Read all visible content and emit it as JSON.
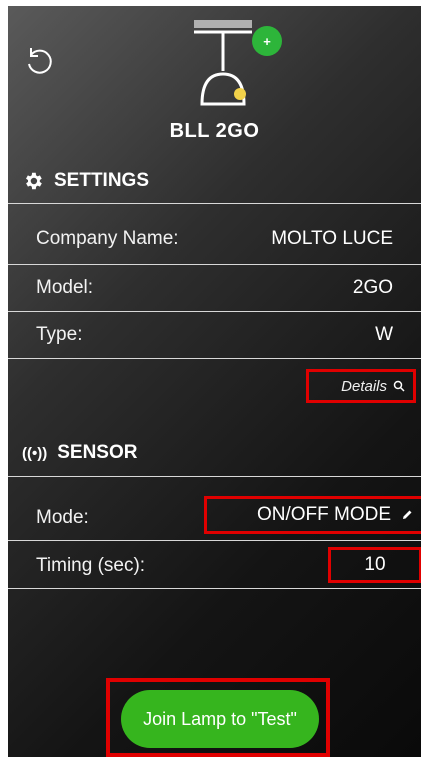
{
  "lamp": {
    "name": "BLL 2GO",
    "add_symbol": "+"
  },
  "settings": {
    "title": "SETTINGS",
    "rows": [
      {
        "label": "Company Name:",
        "value": "MOLTO LUCE"
      },
      {
        "label": "Model:",
        "value": "2GO"
      },
      {
        "label": "Type:",
        "value": "W"
      }
    ],
    "details_label": "Details"
  },
  "sensor": {
    "title": "SENSOR",
    "icon_text": "((•))",
    "mode_label": "Mode:",
    "mode_value": "ON/OFF MODE",
    "timing_label": "Timing (sec):",
    "timing_value": "10"
  },
  "join_button": {
    "label": "Join Lamp to \"Test\""
  },
  "icons": {
    "refresh": "refresh-icon",
    "gear": "gear-icon",
    "search": "search-icon",
    "pencil": "pencil-icon",
    "sensor": "sensor-icon"
  },
  "colors": {
    "accent_green": "#36b51e",
    "highlight_red": "#e00000"
  }
}
